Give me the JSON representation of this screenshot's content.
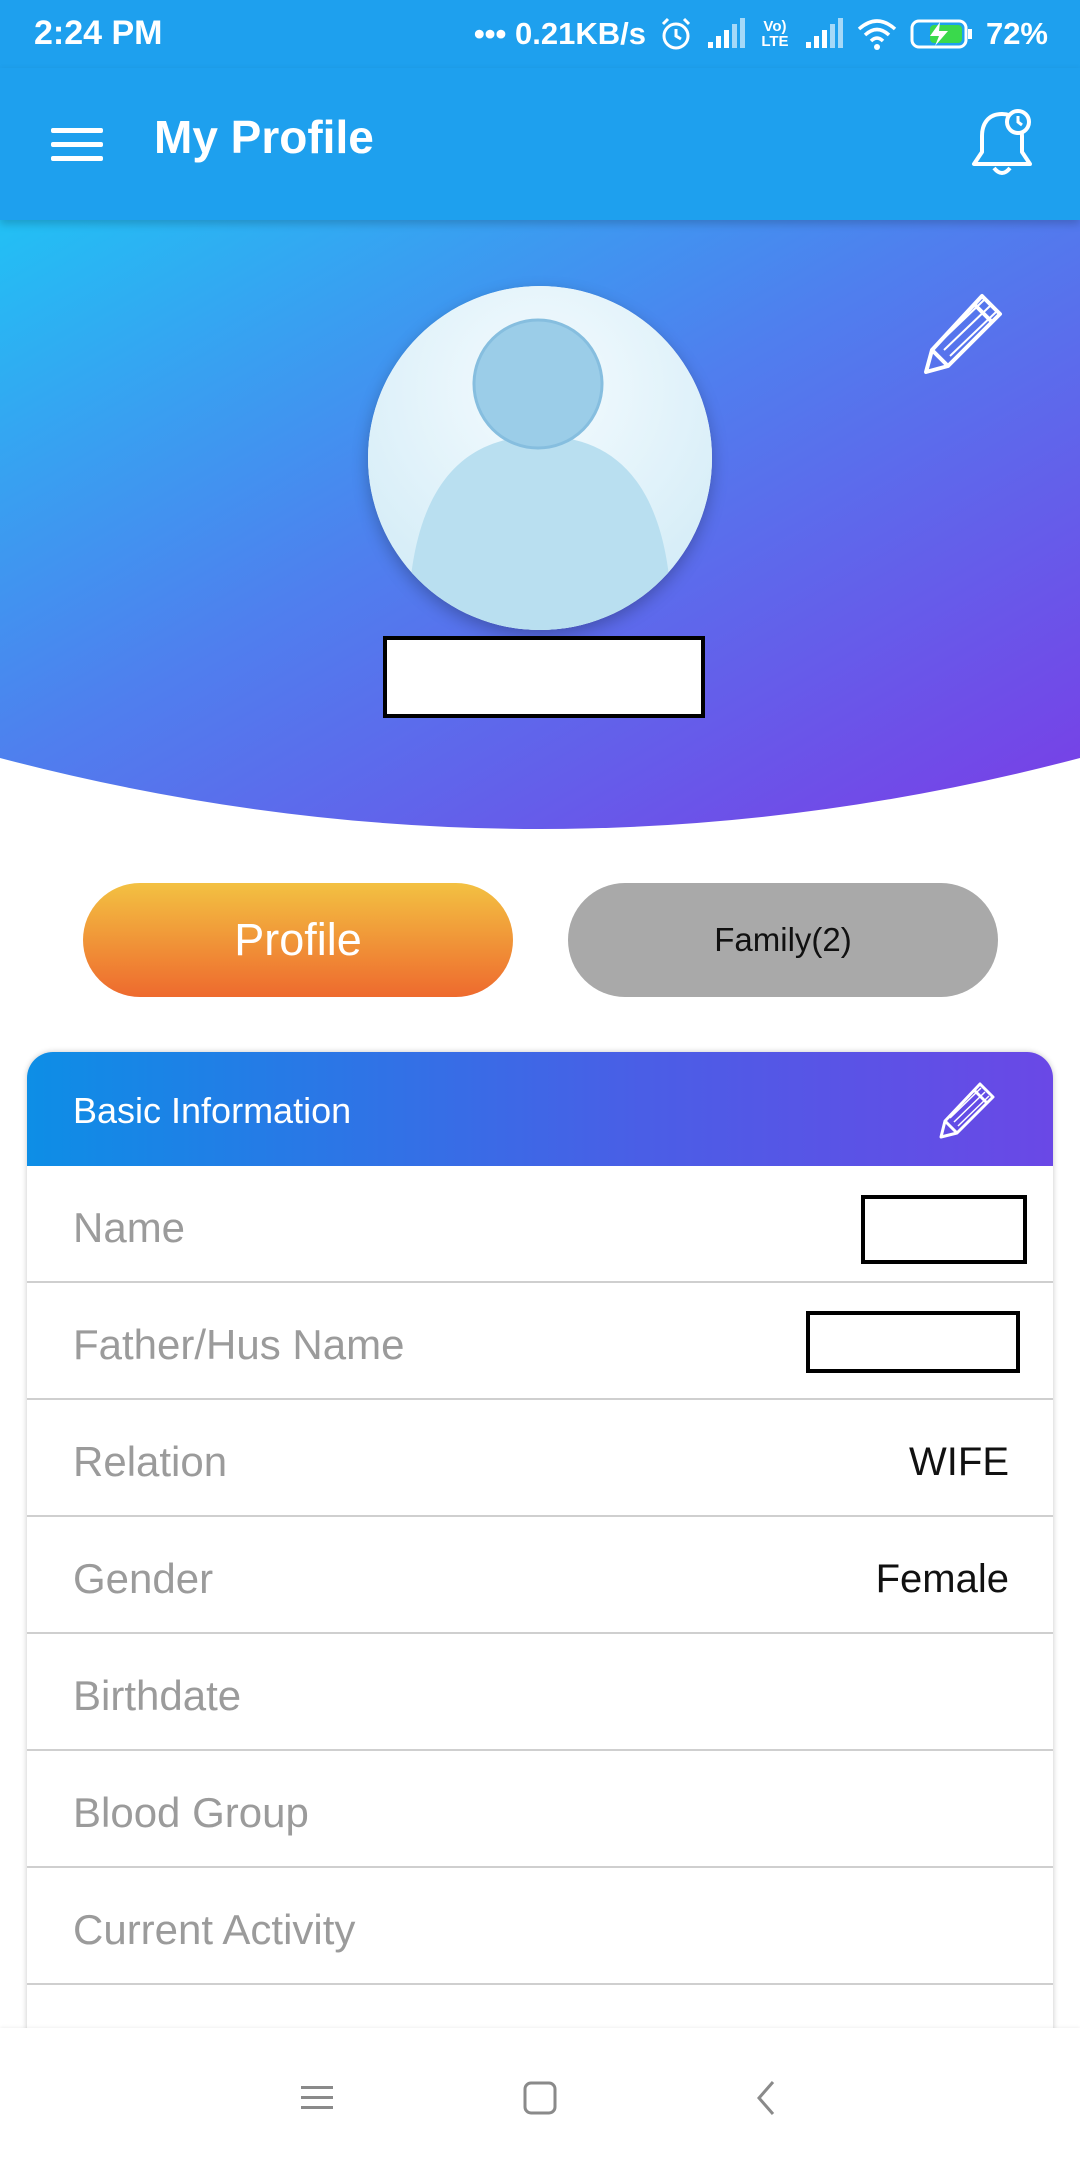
{
  "status_bar": {
    "time": "2:24 PM",
    "network_speed": "••• 0.21KB/s",
    "volte_label": "Vo) LTE",
    "battery": "72%"
  },
  "app_bar": {
    "title": "My Profile"
  },
  "tabs": {
    "profile": "Profile",
    "family": "Family(2)"
  },
  "basic_info": {
    "header": "Basic Information",
    "rows": [
      {
        "label": "Name",
        "value": ""
      },
      {
        "label": "Father/Hus Name",
        "value": ""
      },
      {
        "label": "Relation",
        "value": "WIFE"
      },
      {
        "label": "Gender",
        "value": "Female"
      },
      {
        "label": "Birthdate",
        "value": ""
      },
      {
        "label": "Blood Group",
        "value": ""
      },
      {
        "label": "Current Activity",
        "value": ""
      }
    ]
  },
  "colors": {
    "primary": "#1ea0ee",
    "hero_start": "#22c0f4",
    "hero_end": "#7a3ce6",
    "tab_active_top": "#f3c142",
    "tab_active_bottom": "#ee6a2e",
    "tab_inactive": "#a9a9a9"
  },
  "icons": {
    "menu": "hamburger-menu-icon",
    "notification": "bell-icon",
    "edit": "pencil-icon",
    "avatar": "person-placeholder-icon"
  }
}
